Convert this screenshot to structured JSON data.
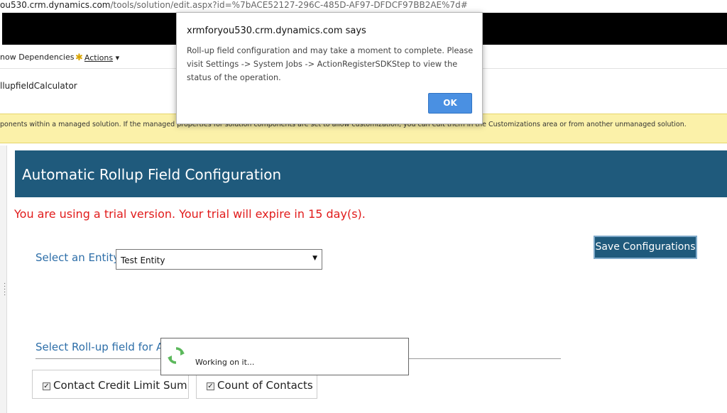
{
  "browser": {
    "url_host": "ou530.crm.dynamics.com",
    "url_path": "/tools/solution/edit.aspx?id=%7bACE52127-296C-485D-AF97-DFDCF97BB2AE%7d#"
  },
  "command_bar": {
    "show_dependencies": "now Dependencies",
    "actions": "Actions"
  },
  "solution_name": "llupfieldCalculator",
  "notice": "ponents within a managed solution. If the managed properties for solution components are set to allow customization, you can edit them in the Customizations area or from another unmanaged solution.",
  "page": {
    "header_title": "Automatic Rollup Field Configuration",
    "trial_message": "You are using a trial version. Your trial will expire in 15 day(s).",
    "entity_label": "Select an Entity",
    "entity_selected": "Test Entity",
    "save_button": "Save Configurations",
    "rollup_label": "Select Roll-up field for Aut",
    "rollup_fields": [
      {
        "label": "Contact Credit Limit Sum",
        "checked": true
      },
      {
        "label": "Count of Contacts",
        "checked": true
      }
    ]
  },
  "working_popup": {
    "text": "Working on it..."
  },
  "alert": {
    "title": "xrmforyou530.crm.dynamics.com says",
    "message": "Roll-up field configuration and may take a moment to complete. Please visit Settings -> System Jobs -> ActionRegisterSDKStep to view the status of the operation.",
    "ok_label": "OK"
  },
  "colors": {
    "header_bg": "#1f5a7c",
    "trial_text": "#e11b1b",
    "label_blue": "#2d6ea8",
    "notice_bg": "#fbf1a9",
    "ok_button": "#4a90e2",
    "spinner": "#5cb85c"
  }
}
